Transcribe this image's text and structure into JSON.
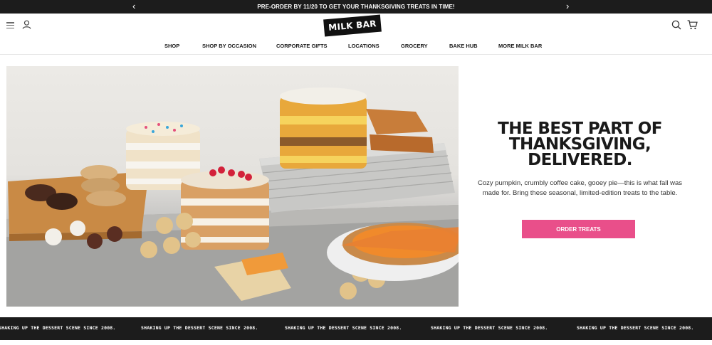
{
  "announcement": {
    "message": "PRE-ORDER BY 11/20 TO GET YOUR THANKSGIVING TREATS IN TIME!",
    "prev_icon": "chevron-left-icon",
    "next_icon": "chevron-right-icon"
  },
  "header": {
    "logo_text": "MILK BAR",
    "icons": [
      "menu-icon",
      "user-icon",
      "search-icon",
      "cart-icon"
    ]
  },
  "nav": {
    "items": [
      "SHOP",
      "SHOP BY OCCASION",
      "CORPORATE GIFTS",
      "LOCATIONS",
      "GROCERY",
      "BAKE HUB",
      "MORE MILK BAR"
    ]
  },
  "hero": {
    "title_lines": [
      "THE BEST PART OF",
      "THANKSGIVING,",
      "DELIVERED."
    ],
    "body": "Cozy pumpkin, crumbly coffee cake, gooey pie—this is what fall was made for. Bring these seasonal, limited-edition treats to the table.",
    "cta_label": "ORDER TREATS"
  },
  "ticker": {
    "text": "SHAKING UP THE DESSERT SCENE SINCE 2008."
  },
  "colors": {
    "accent": "#e94f8a",
    "dark_bar": "#1c1c1c"
  }
}
